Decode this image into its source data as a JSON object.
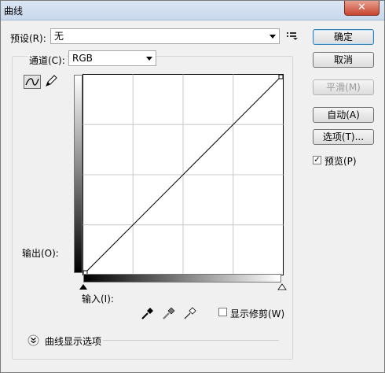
{
  "window": {
    "title": "曲线",
    "close_glyph": "✕"
  },
  "preset": {
    "label": "预设(R):",
    "value": "无"
  },
  "channel": {
    "label": "通道(C):",
    "value": "RGB"
  },
  "buttons": {
    "ok": "确定",
    "cancel": "取消",
    "smooth": "平滑(M)",
    "auto": "自动(A)",
    "options": "选项(T)..."
  },
  "preview": {
    "label": "预览(P)",
    "checked": true,
    "check_glyph": "✓"
  },
  "output_label": "输出(O):",
  "input_label": "输入(I):",
  "show_clipping": {
    "label": "显示修剪(W)",
    "checked": false
  },
  "curve_display_options": "曲线显示选项",
  "icons": {
    "preset_menu": "preset-options-icon",
    "curve_tool": "curve-tool-icon",
    "pencil_tool": "pencil-tool-icon",
    "black_point": "eyedropper-black-icon",
    "gray_point": "eyedropper-gray-icon",
    "white_point": "eyedropper-white-icon",
    "expand": "double-chevron-down-icon"
  },
  "curve": {
    "points": [
      [
        0,
        0
      ],
      [
        255,
        255
      ]
    ],
    "grid_divisions": 4,
    "input_range": [
      0,
      255
    ],
    "output_range": [
      0,
      255
    ]
  }
}
